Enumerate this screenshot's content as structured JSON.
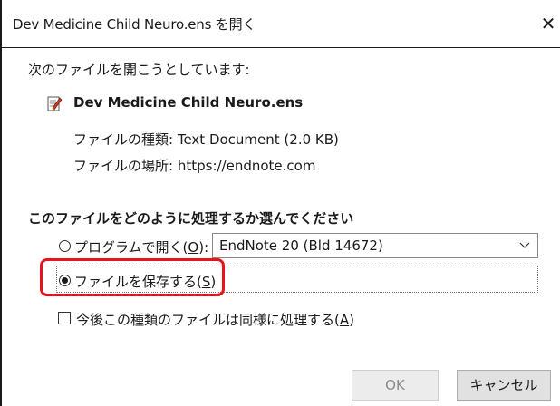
{
  "window": {
    "title": "Dev Medicine Child Neuro.ens を開く",
    "close_glyph": "✕"
  },
  "intro": {
    "prompt": "次のファイルを開こうとしています:",
    "file_icon": "text-document-icon",
    "filename": "Dev Medicine Child Neuro.ens",
    "type_label": "ファイルの種類:",
    "type_value": "Text Document (2.0 KB)",
    "location_label": "ファイルの場所:",
    "location_value": "https://endnote.com"
  },
  "action": {
    "question": "このファイルをどのように処理するか選んでください",
    "open_with_prefix": "プログラムで開く(",
    "open_with_key": "O",
    "open_with_suffix": "):",
    "open_with_checked": false,
    "program_selected": "EndNote 20 (Bld 14672)",
    "save_prefix": "ファイルを保存する(",
    "save_key": "S",
    "save_suffix": ")",
    "save_checked": true,
    "highlight_color": "#e8131b"
  },
  "remember": {
    "prefix": "今後この種類のファイルは同様に処理する(",
    "key": "A",
    "suffix": ")",
    "checked": false
  },
  "buttons": {
    "ok_label": "OK",
    "ok_enabled": false,
    "cancel_label": "キャンセル"
  }
}
